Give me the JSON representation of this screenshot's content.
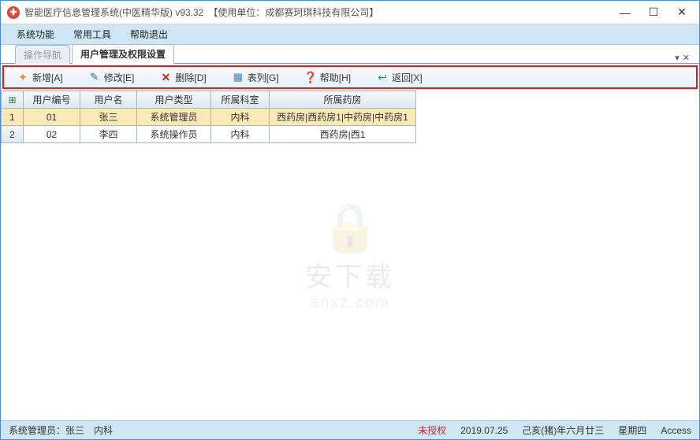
{
  "titlebar": {
    "title": "智能医疗信息管理系统(中医精华版) v93.32　【使用单位：成都赛珂琪科技有限公司】"
  },
  "menubar": {
    "items": [
      "系统功能",
      "常用工具",
      "帮助退出"
    ]
  },
  "tabs": {
    "items": [
      {
        "label": "操作导航",
        "active": false
      },
      {
        "label": "用户管理及权限设置",
        "active": true
      }
    ]
  },
  "toolbar": {
    "add": "新增[A]",
    "edit": "修改[E]",
    "del": "删除[D]",
    "list": "表列[G]",
    "help": "帮助[H]",
    "back": "返回[X]"
  },
  "grid": {
    "headers": [
      "用户编号",
      "用户名",
      "用户类型",
      "所属科室",
      "所属药房"
    ],
    "rows": [
      {
        "n": "1",
        "id": "01",
        "name": "张三",
        "type": "系统管理员",
        "dept": "内科",
        "pharm": "西药房|西药房1|中药房|中药房1",
        "selected": true
      },
      {
        "n": "2",
        "id": "02",
        "name": "李四",
        "type": "系统操作员",
        "dept": "内科",
        "pharm": "西药房|西1",
        "selected": false
      }
    ]
  },
  "watermark": {
    "t1": "安下载",
    "t2": "anxz.com"
  },
  "statusbar": {
    "left": "系统管理员：张三　内科",
    "auth": "未授权",
    "date": "2019.07.25",
    "lunar": "己亥(猪)年六月廿三",
    "weekday": "星期四",
    "db": "Access"
  }
}
